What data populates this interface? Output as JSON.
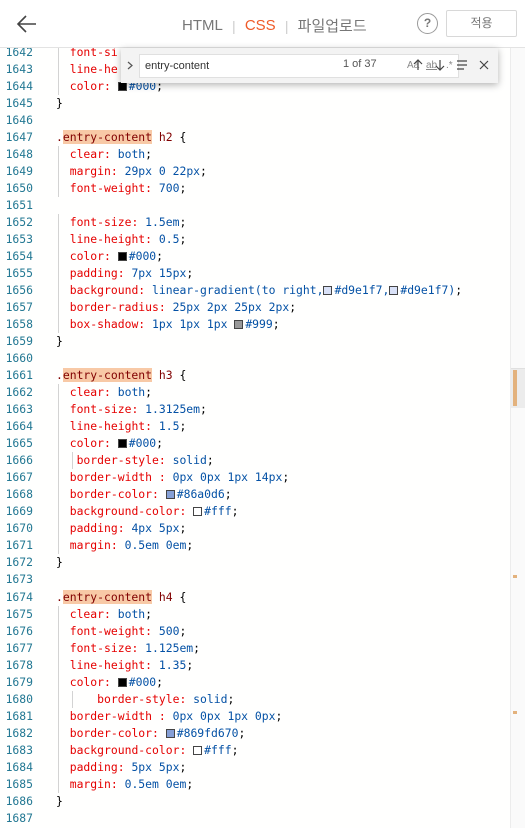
{
  "header": {
    "tabs": [
      {
        "label": "HTML",
        "active": false
      },
      {
        "label": "CSS",
        "active": true
      },
      {
        "label": "파일업로드",
        "active": false
      }
    ],
    "help_label": "?",
    "apply_label": "적용"
  },
  "find_widget": {
    "query": "entry-content",
    "match_case_label": "Aa",
    "whole_word_label": "ab",
    "regex_label": ".*",
    "match_count": "1 of 37"
  },
  "editor": {
    "lines": [
      {
        "n": "1642",
        "html": "  <span class='prop'>font-si</span>"
      },
      {
        "n": "1643",
        "html": "  <span class='prop'>line-he</span>"
      },
      {
        "n": "1644",
        "html": "  <span class='prop'>color:</span> <span class='sw' style='background:#000'></span><span class='val'>#000</span>;"
      },
      {
        "n": "1645",
        "html": "}"
      },
      {
        "n": "1646",
        "html": ""
      },
      {
        "n": "1647",
        "html": "<span class='sel'>.<span class='hl'>entry-content</span> h2</span> {"
      },
      {
        "n": "1648",
        "html": "  <span class='prop'>clear:</span> <span class='val'>both</span>;"
      },
      {
        "n": "1649",
        "html": "  <span class='prop'>margin:</span> <span class='val'>29px 0 22px</span>;"
      },
      {
        "n": "1650",
        "html": "  <span class='prop'>font-weight:</span> <span class='val'>700</span>;"
      },
      {
        "n": "1651",
        "html": ""
      },
      {
        "n": "1652",
        "html": "  <span class='prop'>font-size:</span> <span class='val'>1.5em</span>;"
      },
      {
        "n": "1653",
        "html": "  <span class='prop'>line-height:</span> <span class='val'>0.5</span>;"
      },
      {
        "n": "1654",
        "html": "  <span class='prop'>color:</span> <span class='sw' style='background:#000'></span><span class='val'>#000</span>;"
      },
      {
        "n": "1655",
        "html": "  <span class='prop'>padding:</span> <span class='val'>7px 15px</span>;"
      },
      {
        "n": "1656",
        "html": "  <span class='prop'>background:</span> <span class='val'>linear-gradient(to right,</span><span class='sw' style='background:#d9e1f7'></span><span class='val'>#d9e1f7,</span><span class='sw' style='background:#d9e1f7'></span><span class='val'>#d9e1f7)</span>;"
      },
      {
        "n": "1657",
        "html": "  <span class='prop'>border-radius:</span> <span class='val'>25px 2px 25px 2px</span>;"
      },
      {
        "n": "1658",
        "html": "  <span class='prop'>box-shadow:</span> <span class='val'>1px 1px 1px </span><span class='sw' style='background:#999'></span><span class='val'>#999</span>;"
      },
      {
        "n": "1659",
        "html": "}"
      },
      {
        "n": "1660",
        "html": ""
      },
      {
        "n": "1661",
        "html": "<span class='sel'>.<span class='hl'>entry-content</span> h3</span> {"
      },
      {
        "n": "1662",
        "html": "  <span class='prop'>clear:</span> <span class='val'>both</span>;"
      },
      {
        "n": "1663",
        "html": "  <span class='prop'>font-size:</span> <span class='val'>1.3125em</span>;"
      },
      {
        "n": "1664",
        "html": "  <span class='prop'>line-height:</span> <span class='val'>1.5</span>;"
      },
      {
        "n": "1665",
        "html": "  <span class='prop'>color:</span> <span class='sw' style='background:#000'></span><span class='val'>#000</span>;"
      },
      {
        "n": "1666",
        "html": "   <span class='prop'>border-style:</span> <span class='val'>solid</span>;"
      },
      {
        "n": "1667",
        "html": "  <span class='prop'>border-width :</span> <span class='val'>0px 0px 1px 14px</span>;"
      },
      {
        "n": "1668",
        "html": "  <span class='prop'>border-color:</span> <span class='sw' style='background:#86a0d6'></span><span class='val'>#86a0d6</span>;"
      },
      {
        "n": "1669",
        "html": "  <span class='prop'>background-color:</span> <span class='sw' style='background:#fff'></span><span class='val'>#fff</span>;"
      },
      {
        "n": "1670",
        "html": "  <span class='prop'>padding:</span> <span class='val'>4px 5px</span>;"
      },
      {
        "n": "1671",
        "html": "  <span class='prop'>margin:</span> <span class='val'>0.5em 0em</span>;"
      },
      {
        "n": "1672",
        "html": "}"
      },
      {
        "n": "1673",
        "html": ""
      },
      {
        "n": "1674",
        "html": "<span class='sel'>.<span class='hl'>entry-content</span> h4</span> {"
      },
      {
        "n": "1675",
        "html": "  <span class='prop'>clear:</span> <span class='val'>both</span>;"
      },
      {
        "n": "1676",
        "html": "  <span class='prop'>font-weight:</span> <span class='val'>500</span>;"
      },
      {
        "n": "1677",
        "html": "  <span class='prop'>font-size:</span> <span class='val'>1.125em</span>;"
      },
      {
        "n": "1678",
        "html": "  <span class='prop'>line-height:</span> <span class='val'>1.35</span>;"
      },
      {
        "n": "1679",
        "html": "  <span class='prop'>color:</span> <span class='sw' style='background:#000'></span><span class='val'>#000</span>;"
      },
      {
        "n": "1680",
        "html": "      <span class='prop'>border-style:</span> <span class='val'>solid</span>;"
      },
      {
        "n": "1681",
        "html": "  <span class='prop'>border-width :</span> <span class='val'>0px 0px 1px 0px</span>;"
      },
      {
        "n": "1682",
        "html": "  <span class='prop'>border-color:</span> <span class='sw' style='background:#869fd6'></span><span class='val'>#869fd670</span>;"
      },
      {
        "n": "1683",
        "html": "  <span class='prop'>background-color:</span> <span class='sw' style='background:#fff'></span><span class='val'>#fff</span>;"
      },
      {
        "n": "1684",
        "html": "  <span class='prop'>padding:</span> <span class='val'>5px 5px</span>;"
      },
      {
        "n": "1685",
        "html": "  <span class='prop'>margin:</span> <span class='val'>0.5em 0em</span>;"
      },
      {
        "n": "1686",
        "html": "}"
      },
      {
        "n": "1687",
        "html": ""
      }
    ]
  },
  "colors": {
    "accent": "#ef5a28",
    "line_number": "#237893",
    "selector": "#800000",
    "property": "#e50000",
    "value": "#0451a5",
    "match_highlight": "#f8c9a6"
  },
  "icons": [
    "back-arrow-icon",
    "help-icon",
    "chevron-right-icon",
    "arrow-up-icon",
    "arrow-down-icon",
    "find-in-selection-icon",
    "close-icon"
  ]
}
